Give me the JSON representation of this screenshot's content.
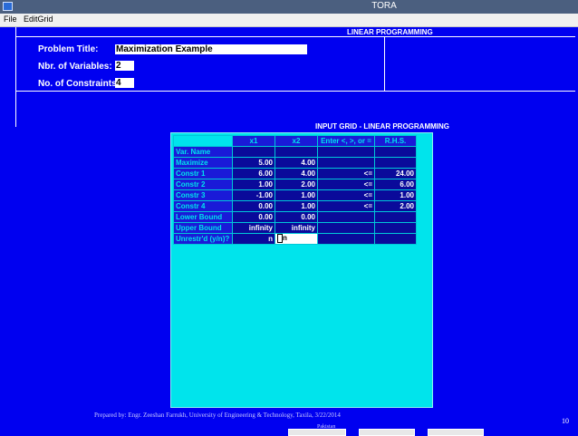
{
  "window": {
    "title": "TORA"
  },
  "menu": {
    "file": "File",
    "editgrid": "EditGrid"
  },
  "header": {
    "section_label": "LINEAR PROGRAMMING"
  },
  "form": {
    "problem_title_label": "Problem Title:",
    "problem_title_value": "Maximization Example",
    "nbr_variables_label": "Nbr. of Variables:",
    "nbr_variables_value": "2",
    "nbr_constraints_label": "No. of Constraints:",
    "nbr_constraints_value": "4"
  },
  "grid": {
    "title": "INPUT GRID - LINEAR PROGRAMMING",
    "columns": [
      "x1",
      "x2",
      "Enter <, >, or =",
      "R.H.S."
    ],
    "rows": [
      {
        "label": "Var. Name",
        "cells": [
          "",
          "",
          "",
          ""
        ]
      },
      {
        "label": "Maximize",
        "cells": [
          "5.00",
          "4.00",
          "",
          ""
        ]
      },
      {
        "label": "Constr 1",
        "cells": [
          "6.00",
          "4.00",
          "<=",
          "24.00"
        ]
      },
      {
        "label": "Constr 2",
        "cells": [
          "1.00",
          "2.00",
          "<=",
          "6.00"
        ]
      },
      {
        "label": "Constr 3",
        "cells": [
          "-1.00",
          "1.00",
          "<=",
          "1.00"
        ]
      },
      {
        "label": "Constr 4",
        "cells": [
          "0.00",
          "1.00",
          "<=",
          "2.00"
        ]
      },
      {
        "label": "Lower Bound",
        "cells": [
          "0.00",
          "0.00",
          "",
          ""
        ]
      },
      {
        "label": "Upper Bound",
        "cells": [
          "infinity",
          "infinity",
          "",
          ""
        ]
      },
      {
        "label": "Unrestr'd (y/n)?",
        "cells": [
          "n",
          "n",
          "",
          ""
        ]
      }
    ]
  },
  "footer": {
    "prepared_by": "Prepared by:  Engr. Zeeshan Farrukh,  University of Engineering & Technology, Taxila,          3/22/2014",
    "country": "Pakistan",
    "page_number": "10"
  }
}
